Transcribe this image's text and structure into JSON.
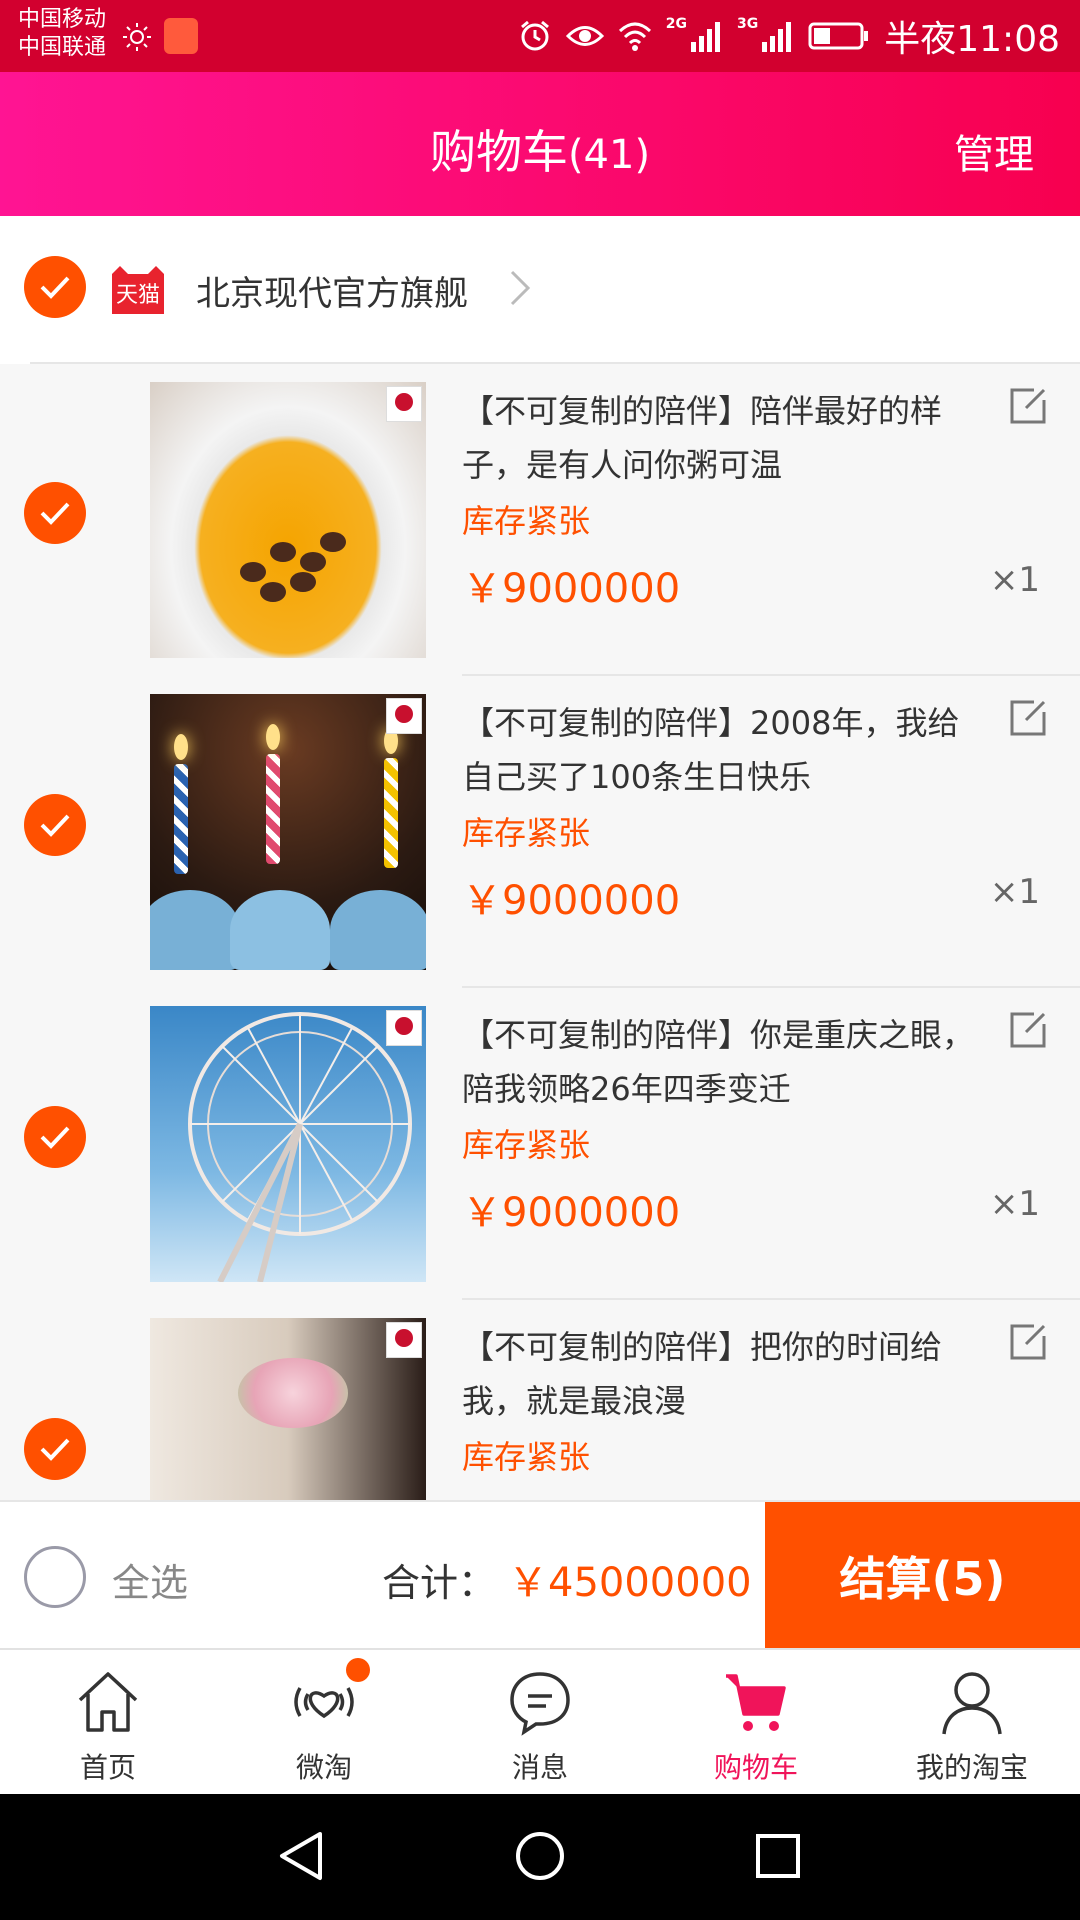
{
  "status_bar": {
    "carrier1": "中国移动",
    "carrier2": "中国联通",
    "net1": "2G",
    "net2": "3G",
    "time": "半夜11:08"
  },
  "header": {
    "title": "购物车",
    "count": "(41)",
    "manage": "管理"
  },
  "store": {
    "logo_text": "天猫",
    "name": "北京现代官方旗舰"
  },
  "items": [
    {
      "name": "【不可复制的陪伴】陪伴最好的样子，是有人问你粥可温",
      "stock": "库存紧张",
      "price": "￥9000000",
      "qty": "×1"
    },
    {
      "name": "【不可复制的陪伴】2008年，我给自己买了100条生日快乐",
      "stock": "库存紧张",
      "price": "￥9000000",
      "qty": "×1"
    },
    {
      "name": "【不可复制的陪伴】你是重庆之眼，陪我领略26年四季变迁",
      "stock": "库存紧张",
      "price": "￥9000000",
      "qty": "×1"
    },
    {
      "name": "【不可复制的陪伴】把你的时间给我，就是最浪漫",
      "stock": "库存紧张"
    }
  ],
  "summary": {
    "select_all": "全选",
    "total_label": "合计：",
    "total_value": "￥45000000",
    "checkout": "结算(5)"
  },
  "tabs": [
    {
      "label": "首页",
      "icon": "home-icon"
    },
    {
      "label": "微淘",
      "icon": "weitao-icon"
    },
    {
      "label": "消息",
      "icon": "message-icon"
    },
    {
      "label": "购物车",
      "icon": "cart-icon",
      "active": true
    },
    {
      "label": "我的淘宝",
      "icon": "profile-icon"
    }
  ],
  "colors": {
    "accent": "#ff5000",
    "header": "#f7004f",
    "status_bar": "#d2002f",
    "active_tab": "#f0145a"
  }
}
